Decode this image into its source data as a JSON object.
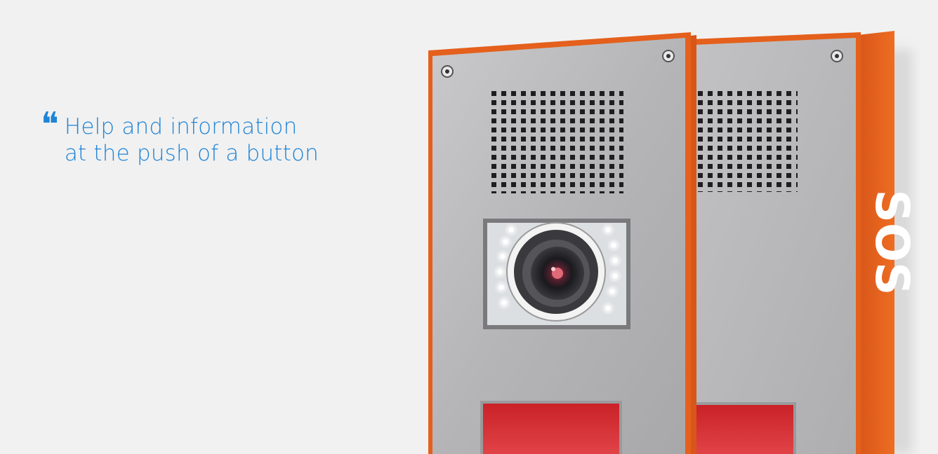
{
  "tagline": {
    "quote_icon": "open-quote-icon",
    "line1": "Help and information",
    "line2": "at the push of a button"
  },
  "device": {
    "side_label": "SOS",
    "accent_color": "#e8641b",
    "button_color": "#d42a2f",
    "text_color": "#1f84d6"
  }
}
